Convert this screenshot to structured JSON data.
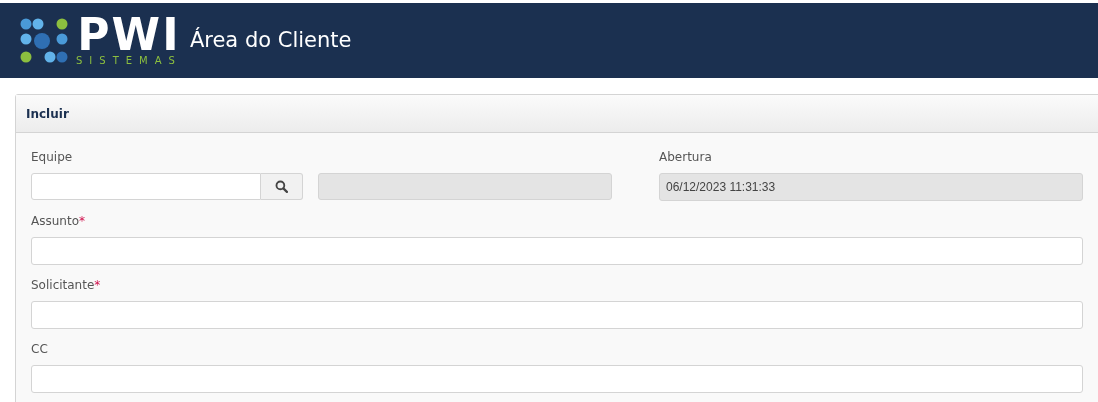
{
  "header": {
    "logo_text": "PWI",
    "logo_subtext": "SISTEMAS",
    "title": "Área do Cliente"
  },
  "panel": {
    "title": "Incluir",
    "fields": [
      {
        "kind": "lookup",
        "label": "Equipe"
      },
      {
        "kind": "readonly",
        "label": "Abertura",
        "value": "06/12/2023 11:31:33"
      },
      {
        "kind": "text",
        "label": "Assunto",
        "required_mark": "*"
      },
      {
        "kind": "text",
        "label": "Solicitante",
        "required_mark": "*"
      },
      {
        "kind": "text",
        "label": "CC"
      }
    ]
  }
}
